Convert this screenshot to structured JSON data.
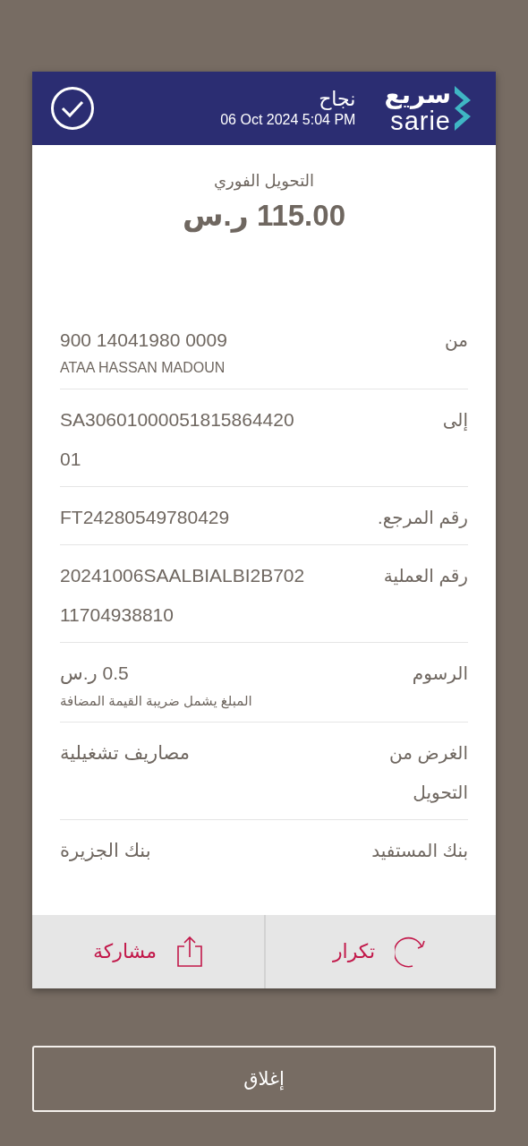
{
  "header": {
    "logo": {
      "arabic": "سريع",
      "latin": "sarie"
    },
    "status": "نجاح",
    "datetime": "06 Oct 2024 5:04 PM"
  },
  "transfer": {
    "type": "التحويل الفوري",
    "amount": "115.00 ر.س"
  },
  "details": [
    {
      "label": "من",
      "value": "900  14041980  0009",
      "note": "ATAA HASSAN MADOUN"
    },
    {
      "label": "إلى",
      "value": "SA30601000051815864420\n01"
    },
    {
      "label": "رقم المرجع.",
      "value": "FT24280549780429"
    },
    {
      "label": "رقم العملية",
      "value": "20241006SAALBIALBI2B702\n11704938810"
    },
    {
      "label": "الرسوم",
      "value": "0.5 ر.س",
      "note": "المبلغ يشمل ضريبة القيمة المضافة"
    },
    {
      "label": "الغرض من\nالتحويل",
      "value": "مصاريف تشغيلية"
    },
    {
      "label": "بنك المستفيد",
      "value": "بنك الجزيرة"
    }
  ],
  "actions": [
    {
      "kind": "repeat",
      "label": "تكرار"
    },
    {
      "kind": "share",
      "label": "مشاركة"
    }
  ],
  "close_button": "إغلاق"
}
